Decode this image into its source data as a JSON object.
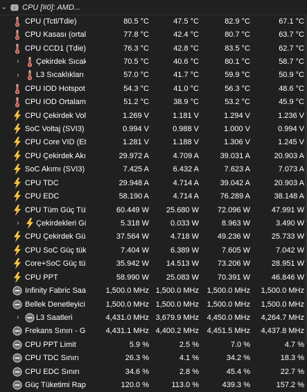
{
  "header": {
    "title": "CPU [#0]: AMD..."
  },
  "rows": [
    {
      "label": "CPU (Tctl/Tdie)",
      "icon": "thermometer",
      "values": [
        "80.5 °C",
        "47.5 °C",
        "82.9 °C",
        "67.1 °C"
      ]
    },
    {
      "label": "CPU Kasası (ortalama)",
      "icon": "thermometer",
      "values": [
        "77.8 °C",
        "42.4 °C",
        "80.7 °C",
        "63.7 °C"
      ]
    },
    {
      "label": "CPU CCD1 (Tdie)",
      "icon": "thermometer",
      "values": [
        "76.3 °C",
        "42.8 °C",
        "83.5 °C",
        "62.7 °C"
      ]
    },
    {
      "label": "Çekirdek Sıcaklıkları",
      "icon": "thermometer",
      "expand": true,
      "values": [
        "70.5 °C",
        "40.6 °C",
        "80.1 °C",
        "58.7 °C"
      ]
    },
    {
      "label": "L3 Sıcaklıkları",
      "icon": "thermometer",
      "expand": true,
      "values": [
        "57.0 °C",
        "41.7 °C",
        "59.9 °C",
        "50.9 °C"
      ]
    },
    {
      "label": "CPU IOD Hotspot",
      "icon": "thermometer",
      "values": [
        "54.3 °C",
        "41.0 °C",
        "56.3 °C",
        "48.6 °C"
      ]
    },
    {
      "label": "CPU IOD Ortalama",
      "icon": "thermometer",
      "values": [
        "51.2 °C",
        "38.9 °C",
        "53.2 °C",
        "45.9 °C"
      ]
    },
    {
      "label": "CPU Çekirdek Voltajı",
      "icon": "bolt",
      "values": [
        "1.269 V",
        "1.181 V",
        "1.294 V",
        "1.236 V"
      ]
    },
    {
      "label": "SoC Voltaj (SVI3)",
      "icon": "bolt",
      "values": [
        "0.994 V",
        "0.988 V",
        "1.000 V",
        "0.994 V"
      ]
    },
    {
      "label": "CPU Core VID (Etkin)",
      "icon": "bolt",
      "values": [
        "1.281 V",
        "1.188 V",
        "1.306 V",
        "1.245 V"
      ]
    },
    {
      "label": "CPU Çekirdek Akımı",
      "icon": "bolt",
      "values": [
        "29.972 A",
        "4.709 A",
        "39.031 A",
        "20.903 A"
      ]
    },
    {
      "label": "SoC Akımı (SVI3)",
      "icon": "bolt",
      "values": [
        "7.425 A",
        "6.432 A",
        "7.623 A",
        "7.073 A"
      ]
    },
    {
      "label": "CPU TDC",
      "icon": "bolt",
      "values": [
        "29.948 A",
        "4.714 A",
        "39.042 A",
        "20.903 A"
      ]
    },
    {
      "label": "CPU EDC",
      "icon": "bolt",
      "values": [
        "58.190 A",
        "4.714 A",
        "76.289 A",
        "38.148 A"
      ]
    },
    {
      "label": "CPU Tüm Güç Tüketimi",
      "icon": "bolt",
      "values": [
        "60.449 W",
        "25.680 W",
        "72.096 W",
        "47.991 W"
      ]
    },
    {
      "label": "Çekirdekleri Güç",
      "icon": "bolt",
      "expand": true,
      "values": [
        "5.318 W",
        "0.033 W",
        "8.963 W",
        "3.490 W"
      ]
    },
    {
      "label": "CPU Çekirdek Güç",
      "icon": "bolt",
      "values": [
        "37.564 W",
        "4.718 W",
        "49.236 W",
        "25.733 W"
      ]
    },
    {
      "label": "CPU SoC Güç tüketimi",
      "icon": "bolt",
      "values": [
        "7.404 W",
        "6.389 W",
        "7.605 W",
        "7.042 W"
      ]
    },
    {
      "label": "Core+SoC Güç tüketimi",
      "icon": "bolt",
      "values": [
        "35.942 W",
        "14.513 W",
        "73.206 W",
        "28.951 W"
      ]
    },
    {
      "label": "CPU PPT",
      "icon": "bolt",
      "values": [
        "58.990 W",
        "25.083 W",
        "70.391 W",
        "46.846 W"
      ]
    },
    {
      "label": "Infinity Fabric Saati",
      "icon": "clock",
      "values": [
        "1,500.0 MHz",
        "1,500.0 MHz",
        "1,500.0 MHz",
        "1,500.0 MHz"
      ]
    },
    {
      "label": "Bellek Denetleyici Saati",
      "icon": "clock",
      "values": [
        "1,500.0 MHz",
        "1,500.0 MHz",
        "1,500.0 MHz",
        "1,500.0 MHz"
      ]
    },
    {
      "label": "L3 Saatleri",
      "icon": "clock",
      "expand": true,
      "values": [
        "4,431.0 MHz",
        "3,679.9 MHz",
        "4,450.0 MHz",
        "4,264.7 MHz"
      ]
    },
    {
      "label": "Frekans Sınırı - Global",
      "icon": "clock",
      "values": [
        "4,431.1 MHz",
        "4,400.2 MHz",
        "4,451.5 MHz",
        "4,437.8 MHz"
      ]
    },
    {
      "label": "CPU PPT Limit",
      "icon": "clock",
      "values": [
        "5.9 %",
        "2.5 %",
        "7.0 %",
        "4.7 %"
      ]
    },
    {
      "label": "CPU TDC Sınırı",
      "icon": "clock",
      "values": [
        "26.3 %",
        "4.1 %",
        "34.2 %",
        "18.3 %"
      ]
    },
    {
      "label": "CPU EDC Sınırı",
      "icon": "clock",
      "values": [
        "34.6 %",
        "2.8 %",
        "45.4 %",
        "22.7 %"
      ]
    },
    {
      "label": "Güç Tüketimi Raporu",
      "icon": "clock",
      "values": [
        "120.0 %",
        "113.0 %",
        "439.3 %",
        "157.2 %"
      ]
    }
  ],
  "colors": {
    "background": "#202020",
    "thermometer": "#d9a7a0",
    "bolt": "#f5c242",
    "clock": "#c8c8c8"
  }
}
